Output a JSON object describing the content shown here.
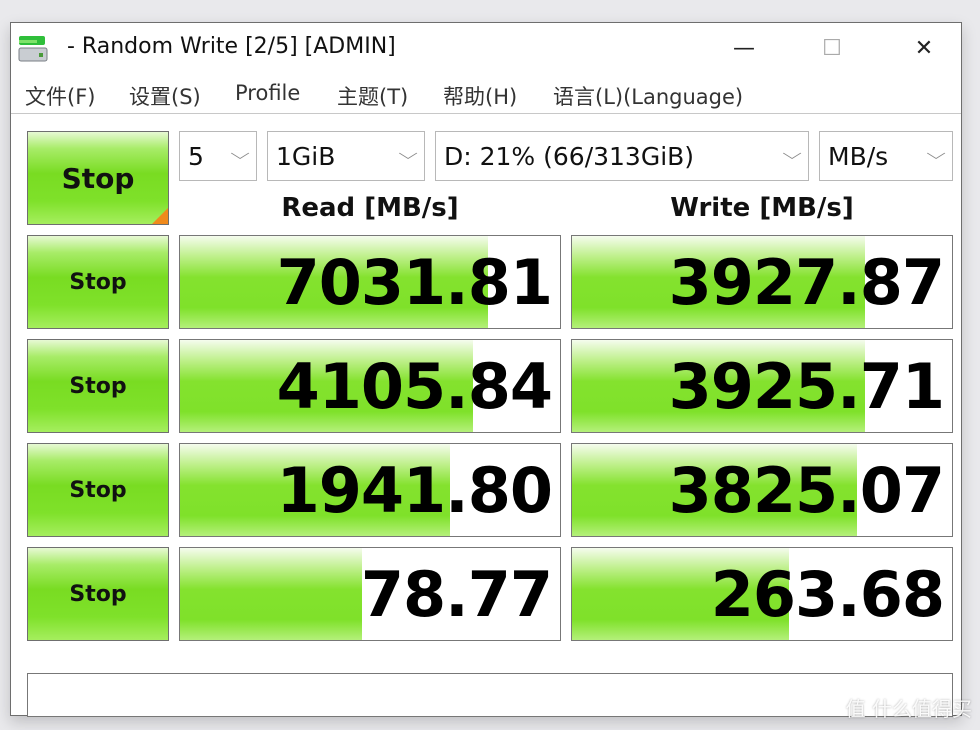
{
  "window": {
    "title": "- Random Write [2/5] [ADMIN]",
    "app_icon": "drive-icon",
    "controls": {
      "minimize": "—",
      "maximize": "☐",
      "close": "✕"
    }
  },
  "menu": [
    {
      "label": "文件(F)"
    },
    {
      "label": "设置(S)"
    },
    {
      "label": "Profile"
    },
    {
      "label": "主题(T)"
    },
    {
      "label": "帮助(H)"
    },
    {
      "label": "语言(L)(Language)"
    }
  ],
  "toolbar": {
    "main_button": "Stop",
    "count_select": "5",
    "size_select": "1GiB",
    "drive_select": "D: 21% (66/313GiB)",
    "unit_select": "MB/s",
    "chevron": "⌵"
  },
  "columns": {
    "read": "Read [MB/s]",
    "write": "Write [MB/s]"
  },
  "rows": [
    {
      "button": "Stop",
      "read": "7031.81",
      "write": "3927.87",
      "read_fill": 0.81,
      "write_fill": 0.77
    },
    {
      "button": "Stop",
      "read": "4105.84",
      "write": "3925.71",
      "read_fill": 0.77,
      "write_fill": 0.77
    },
    {
      "button": "Stop",
      "read": "1941.80",
      "write": "3825.07",
      "read_fill": 0.71,
      "write_fill": 0.75
    },
    {
      "button": "Stop",
      "read": "78.77",
      "write": "263.68",
      "read_fill": 0.48,
      "write_fill": 0.57
    }
  ],
  "status_text": "",
  "watermark": "值 什么值得买"
}
